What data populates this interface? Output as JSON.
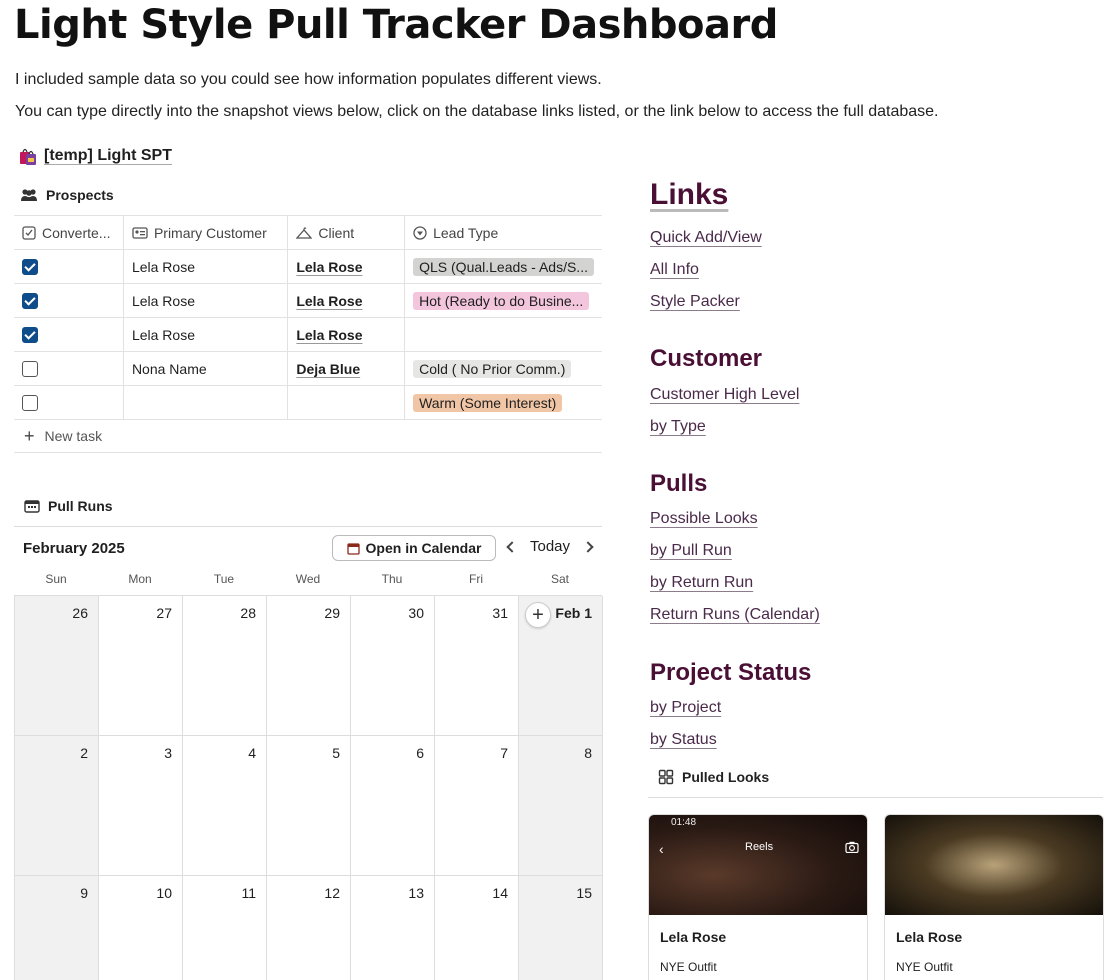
{
  "page": {
    "title": "Light Style Pull Tracker Dashboard",
    "intro1": "I included sample data so you could see how information populates different views.",
    "intro2": "You can type directly into the snapshot views below, click on the database links listed, or the link below to access the full database."
  },
  "database_link": {
    "label": "[temp] Light SPT"
  },
  "prospects": {
    "title": "Prospects",
    "columns": [
      "Converte...",
      "Primary Customer",
      "Client",
      "Lead Type"
    ],
    "rows": [
      {
        "converted": true,
        "primary": "Lela Rose",
        "client": "Lela Rose",
        "lead": "QLS (Qual.Leads - Ads/S...",
        "lead_color": "#d3d3d1"
      },
      {
        "converted": true,
        "primary": "Lela Rose",
        "client": "Lela Rose",
        "lead": "Hot (Ready to do Busine...",
        "lead_color": "#f3c6de"
      },
      {
        "converted": true,
        "primary": "Lela Rose",
        "client": "Lela Rose",
        "lead": "",
        "lead_color": ""
      },
      {
        "converted": false,
        "primary": "Nona Name",
        "client": "Deja Blue",
        "lead": "Cold ( No Prior Comm.)",
        "lead_color": "#e6e6e4"
      },
      {
        "converted": false,
        "primary": "",
        "client": "",
        "lead": "Warm (Some Interest)",
        "lead_color": "#f1c6a6"
      }
    ],
    "new_task": "New task"
  },
  "pull_runs": {
    "title": "Pull Runs",
    "month": "February 2025",
    "open_calendar": "Open in Calendar",
    "today": "Today",
    "weekdays": [
      "Sun",
      "Mon",
      "Tue",
      "Wed",
      "Thu",
      "Fri",
      "Sat"
    ],
    "weeks": [
      [
        "26",
        "27",
        "28",
        "29",
        "30",
        "31",
        "Feb 1"
      ],
      [
        "2",
        "3",
        "4",
        "5",
        "6",
        "7",
        "8"
      ],
      [
        "9",
        "10",
        "11",
        "12",
        "13",
        "14",
        "15"
      ]
    ]
  },
  "links": {
    "heading": "Links",
    "items": [
      "Quick Add/View",
      "All Info",
      "Style Packer"
    ]
  },
  "customer": {
    "heading": "Customer",
    "items": [
      "Customer High Level",
      "by Type"
    ]
  },
  "pulls": {
    "heading": "Pulls",
    "items": [
      "Possible Looks",
      "by Pull Run",
      "by Return Run",
      "Return Runs (Calendar)"
    ]
  },
  "project_status": {
    "heading": "Project Status",
    "items": [
      "by Project",
      "by Status"
    ]
  },
  "pulled_looks": {
    "title": "Pulled Looks",
    "cards": [
      {
        "name": "Lela Rose",
        "outfit": "NYE Outfit",
        "status_time": "01:48",
        "overlay": "Reels"
      },
      {
        "name": "Lela Rose",
        "outfit": "NYE Outfit"
      }
    ]
  },
  "colors": {
    "accent_heading": "#4a0f35",
    "checkbox_on": "#0f4c8a"
  }
}
